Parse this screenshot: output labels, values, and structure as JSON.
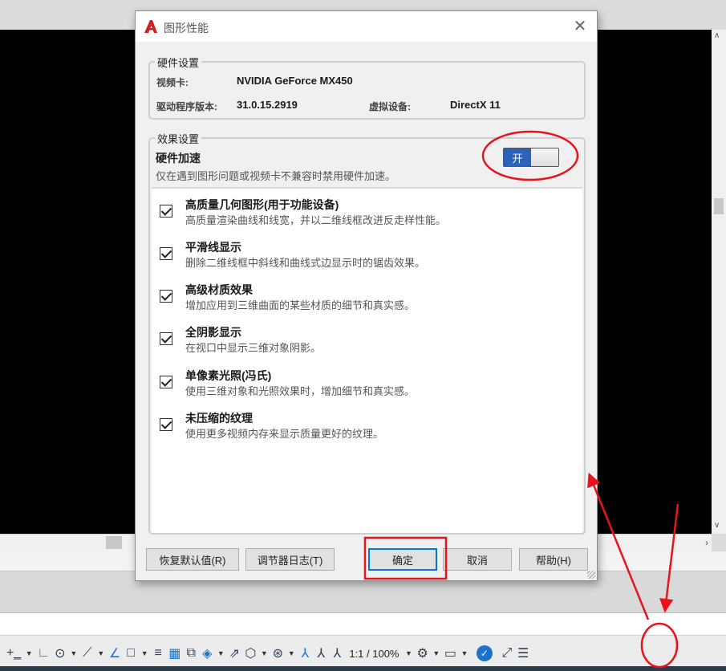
{
  "dialog": {
    "title": "图形性能",
    "hardware": {
      "legend": "硬件设置",
      "video_card_label": "视频卡:",
      "video_card_value": "NVIDIA GeForce MX450",
      "driver_label": "驱动程序版本:",
      "driver_value": "31.0.15.2919",
      "virtual_device_label": "虚拟设备:",
      "virtual_device_value": "DirectX 11"
    },
    "effects": {
      "legend": "效果设置",
      "accel_title": "硬件加速",
      "accel_desc": "仅在遇到图形问题或视频卡不兼容时禁用硬件加速。",
      "toggle_label": "开",
      "toggle_on": true,
      "items": [
        {
          "title": "高质量几何图形(用于功能设备)",
          "desc": "高质量渲染曲线和线宽，并以二维线框改进反走样性能。",
          "checked": true
        },
        {
          "title": "平滑线显示",
          "desc": "删除二维线框中斜线和曲线式边显示时的锯齿效果。",
          "checked": true
        },
        {
          "title": "高级材质效果",
          "desc": "增加应用到三维曲面的某些材质的细节和真实感。",
          "checked": true
        },
        {
          "title": "全阴影显示",
          "desc": "在视口中显示三维对象阴影。",
          "checked": true
        },
        {
          "title": "单像素光照(冯氏)",
          "desc": "使用三维对象和光照效果时，增加细节和真实感。",
          "checked": true
        },
        {
          "title": "未压缩的纹理",
          "desc": "使用更多视频内存来显示质量更好的纹理。",
          "checked": true
        }
      ]
    },
    "buttons": {
      "restore": "恢复默认值(R)",
      "log": "调节器日志(T)",
      "ok": "确定",
      "cancel": "取消",
      "help": "帮助(H)"
    }
  },
  "statusbar": {
    "scale": "1:1 / 100%"
  },
  "colors": {
    "annotation": "#e8141c",
    "toggle_on": "#2c63b8",
    "accent": "#1b72c9"
  }
}
